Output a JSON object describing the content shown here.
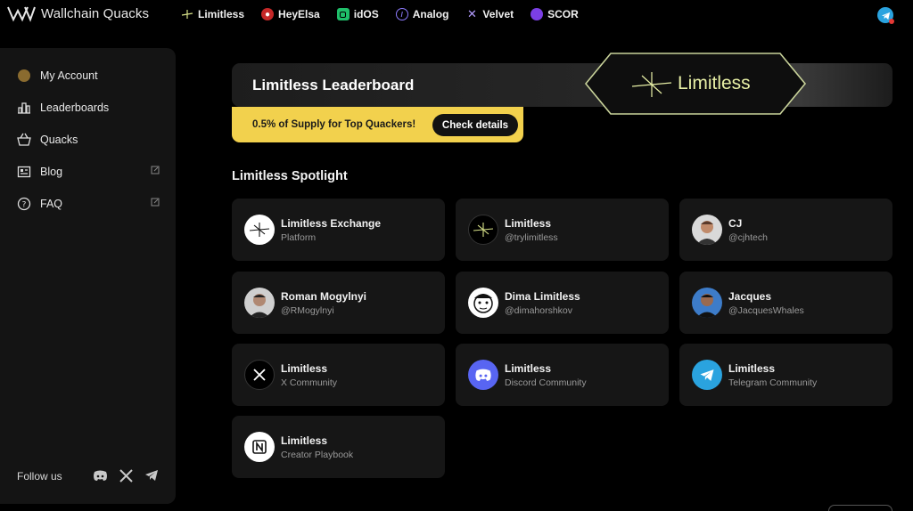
{
  "app": {
    "brand": "Wallchain Quacks"
  },
  "partners": [
    {
      "name": "Limitless",
      "icon": "limitless-star-icon"
    },
    {
      "name": "HeyElsa",
      "icon": "heyelsa-icon"
    },
    {
      "name": "idOS",
      "icon": "idos-icon"
    },
    {
      "name": "Analog",
      "icon": "analog-icon"
    },
    {
      "name": "Velvet",
      "icon": "velvet-icon"
    },
    {
      "name": "SCOR",
      "icon": "scor-icon"
    }
  ],
  "sidebar": {
    "items": [
      {
        "label": "My Account",
        "icon": "user-avatar-icon"
      },
      {
        "label": "Leaderboards",
        "icon": "bar-chart-icon"
      },
      {
        "label": "Quacks",
        "icon": "basket-icon"
      },
      {
        "label": "Blog",
        "icon": "news-icon",
        "external": true
      },
      {
        "label": "FAQ",
        "icon": "question-icon",
        "external": true
      }
    ],
    "follow_label": "Follow us",
    "socials": [
      "discord-icon",
      "x-icon",
      "telegram-icon"
    ]
  },
  "hero": {
    "title": "Limitless Leaderboard",
    "badge": "Limitless",
    "promo_text": "0.5% of Supply for Top Quackers!",
    "promo_button": "Check details"
  },
  "spotlight": {
    "title": "Limitless Spotlight",
    "cards": [
      {
        "name": "Limitless Exchange",
        "sub": "Platform",
        "avatar": "limitless-white"
      },
      {
        "name": "Limitless",
        "sub": "@trylimitless",
        "avatar": "limitless-black"
      },
      {
        "name": "CJ",
        "sub": "@cjhtech",
        "avatar": "person"
      },
      {
        "name": "Roman Mogylnyi",
        "sub": "@RMogylnyi",
        "avatar": "person"
      },
      {
        "name": "Dima Limitless",
        "sub": "@dimahorshkov",
        "avatar": "cartoon"
      },
      {
        "name": "Jacques",
        "sub": "@JacquesWhales",
        "avatar": "person"
      },
      {
        "name": "Limitless",
        "sub": "X Community",
        "avatar": "x"
      },
      {
        "name": "Limitless",
        "sub": "Discord Community",
        "avatar": "discord"
      },
      {
        "name": "Limitless",
        "sub": "Telegram Community",
        "avatar": "telegram"
      },
      {
        "name": "Limitless",
        "sub": "Creator Playbook",
        "avatar": "notion"
      }
    ]
  },
  "colors": {
    "accent_yellow": "#f2d14d",
    "badge_text": "#e8f0a6",
    "card_bg": "#161616"
  }
}
